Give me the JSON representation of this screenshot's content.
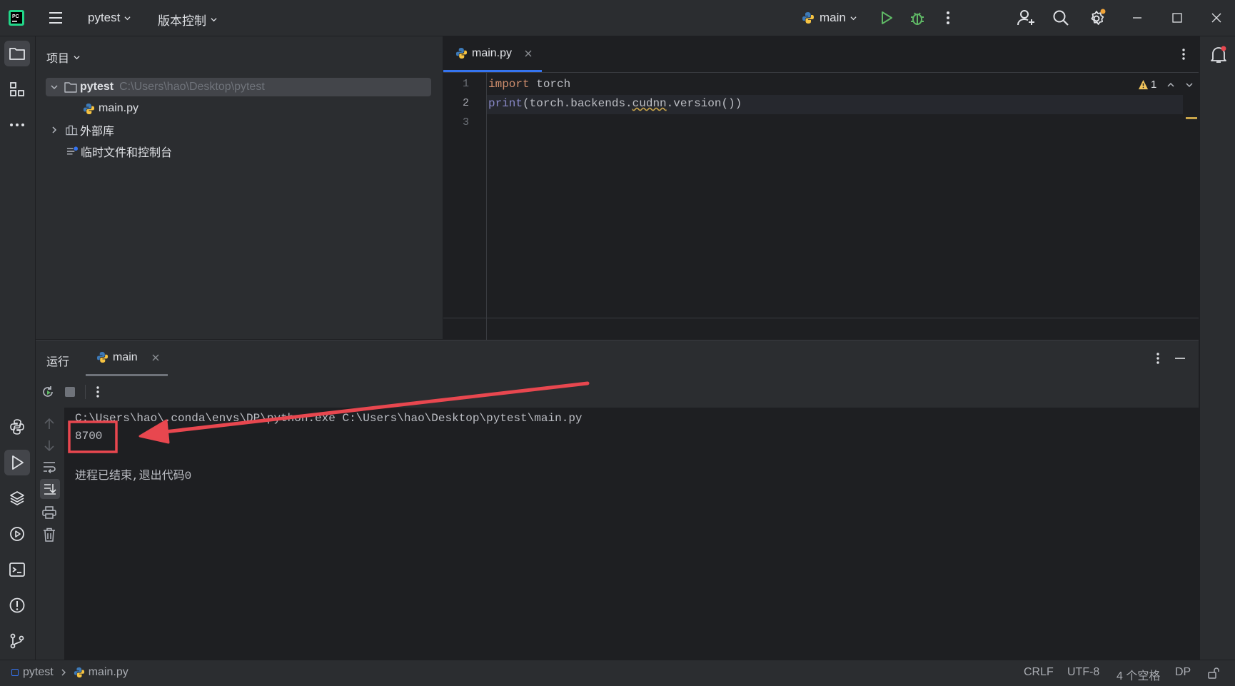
{
  "titlebar": {
    "project_name": "pytest",
    "vcs_label": "版本控制",
    "run_config": "main"
  },
  "project_panel": {
    "title": "项目",
    "root": {
      "name": "pytest",
      "path": "C:\\Users\\hao\\Desktop\\pytest"
    },
    "items": [
      {
        "label": "main.py"
      },
      {
        "label": "外部库"
      },
      {
        "label": "临时文件和控制台"
      }
    ]
  },
  "editor": {
    "tab_label": "main.py",
    "warning_count": "1",
    "line_numbers": [
      "1",
      "2",
      "3"
    ],
    "lines": [
      {
        "kw": "import",
        "rest": " torch"
      },
      {
        "fn": "print",
        "p1": "(torch.backends.",
        "u": "cudnn",
        "p2": ".version())"
      },
      {
        "text": ""
      }
    ]
  },
  "run_panel": {
    "title": "运行",
    "tab_label": "main",
    "output": [
      "C:\\Users\\hao\\.conda\\envs\\DP\\python.exe C:\\Users\\hao\\Desktop\\pytest\\main.py",
      "8700",
      "",
      "进程已结束,退出代码0"
    ]
  },
  "statusbar": {
    "breadcrumb_project": "pytest",
    "breadcrumb_file": "main.py",
    "line_separator": "CRLF",
    "encoding": "UTF-8",
    "indent": "4 个空格",
    "interpreter": "DP"
  },
  "colors": {
    "annotation": "#e8474f",
    "run_green": "#5fb865",
    "accent_blue": "#3574f0",
    "python_blue": "#3d7ab8",
    "python_yellow": "#f6c342"
  }
}
